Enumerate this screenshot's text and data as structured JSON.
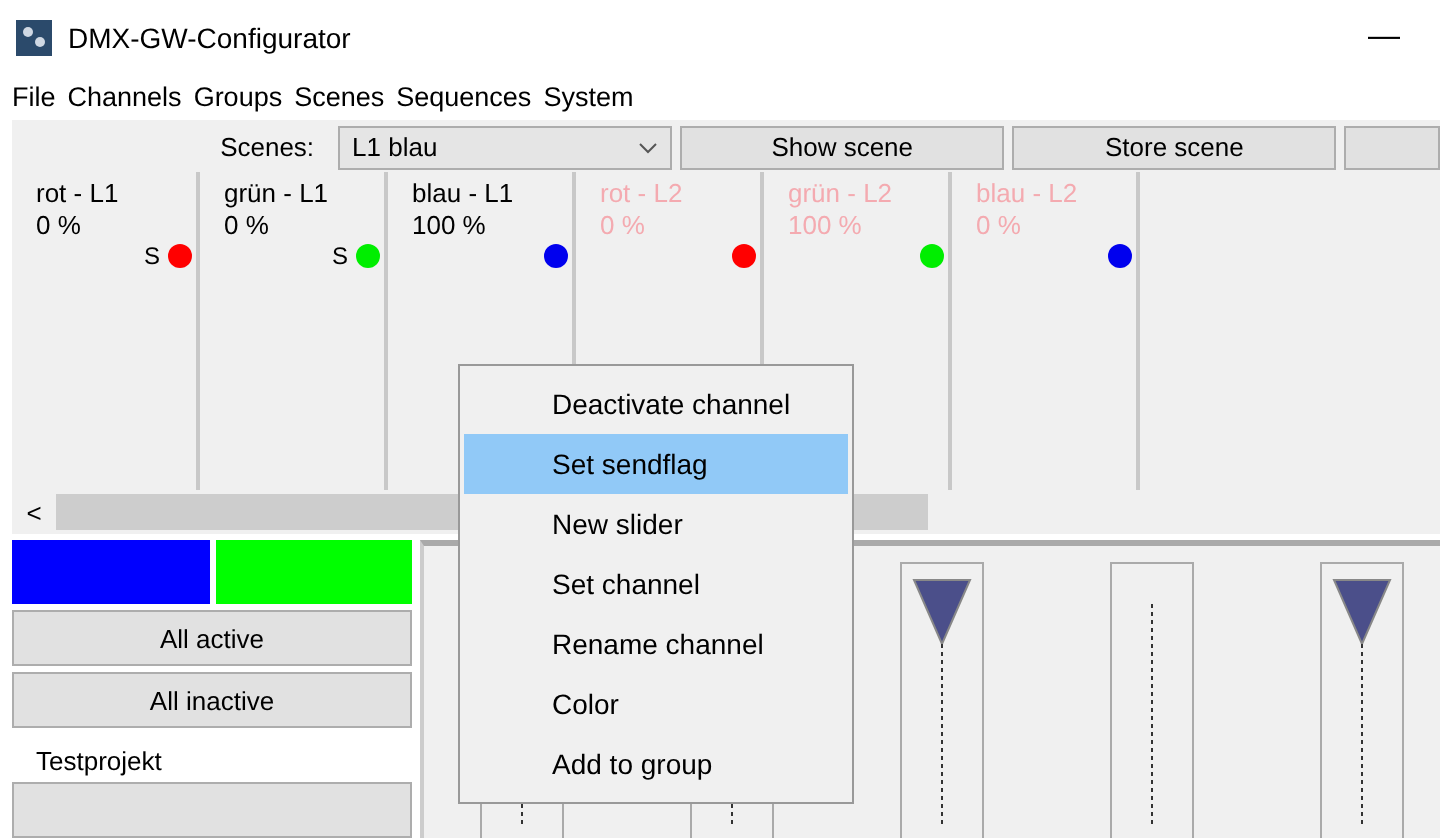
{
  "window": {
    "title": "DMX-GW-Configurator",
    "minimize": "—"
  },
  "menu": [
    "File",
    "Channels",
    "Groups",
    "Scenes",
    "Sequences",
    "System"
  ],
  "toolbar": {
    "label": "Scenes:",
    "scene": "L1 blau",
    "buttons": [
      "Show scene",
      "Store scene"
    ]
  },
  "channels": [
    {
      "name": "rot - L1",
      "value": "0 %",
      "color": "#ff0000",
      "sendflag": "S",
      "active": true
    },
    {
      "name": "grün - L1",
      "value": "0 %",
      "color": "#00ee00",
      "sendflag": "S",
      "active": true
    },
    {
      "name": "blau - L1",
      "value": "100 %",
      "color": "#0000ee",
      "active": true
    },
    {
      "name": "rot - L2",
      "value": "0 %",
      "color": "#ff0000",
      "active": false
    },
    {
      "name": "grün - L2",
      "value": "100 %",
      "color": "#00ee00",
      "active": false
    },
    {
      "name": "blau - L2",
      "value": "0 %",
      "color": "#0000ee",
      "active": false
    }
  ],
  "scroll_left": "<",
  "groups": [
    {
      "color": "#0000ff"
    },
    {
      "color": "#00ff00"
    }
  ],
  "group_buttons": [
    "All active",
    "All inactive"
  ],
  "project": "Testprojekt",
  "faders": [
    {
      "kind": "line"
    },
    {
      "kind": "line"
    },
    {
      "kind": "thumb"
    },
    {
      "kind": "line"
    },
    {
      "kind": "thumb"
    }
  ],
  "context_menu": [
    {
      "label": "Deactivate channel",
      "selected": false
    },
    {
      "label": "Set sendflag",
      "selected": true
    },
    {
      "label": "New slider",
      "selected": false
    },
    {
      "label": "Set channel",
      "selected": false
    },
    {
      "label": "Rename channel",
      "selected": false
    },
    {
      "label": "Color",
      "selected": false
    },
    {
      "label": "Add to group",
      "selected": false
    }
  ]
}
